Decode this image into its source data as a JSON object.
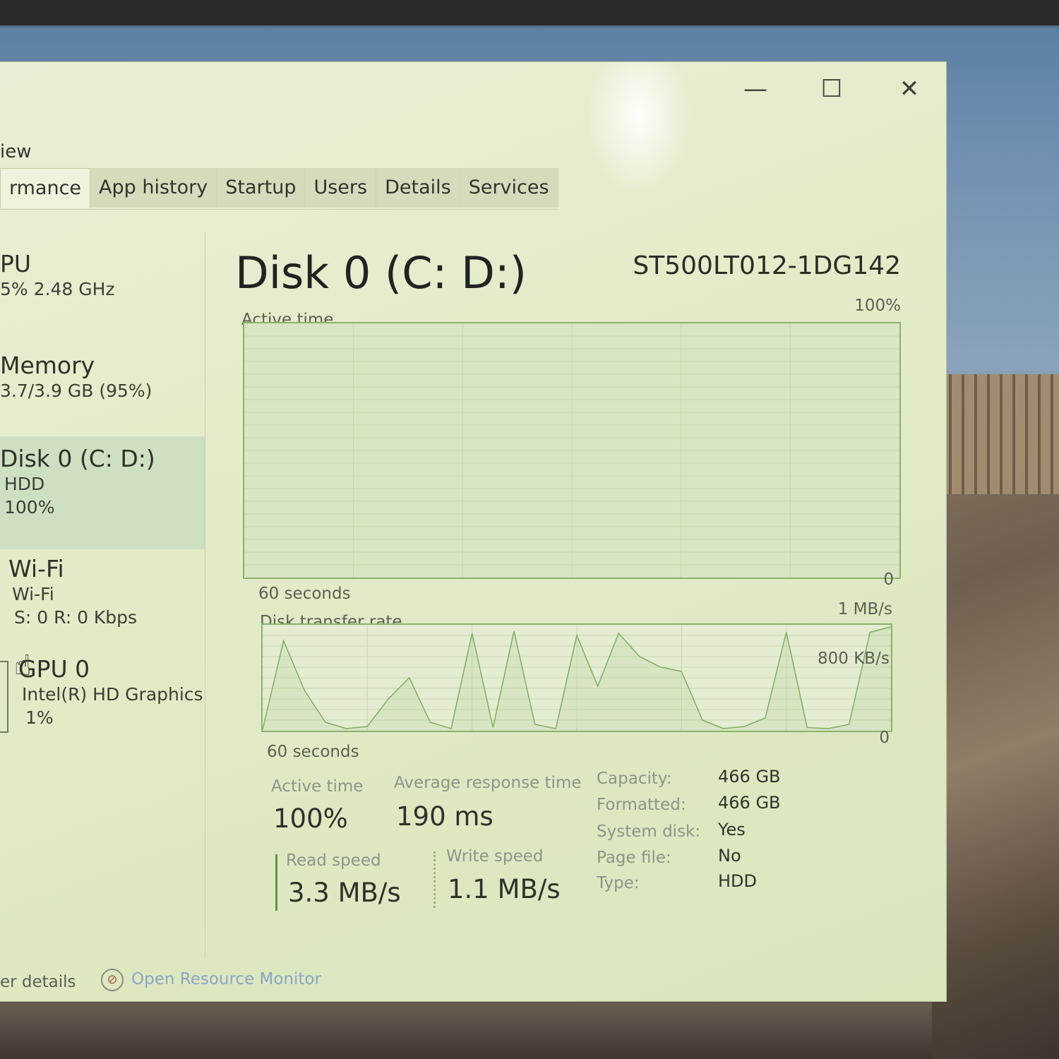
{
  "window": {
    "controls": {
      "minimize": "—",
      "maximize": "☐",
      "close": "✕"
    },
    "menu_partial": "iew"
  },
  "tabs": [
    "rmance",
    "App history",
    "Startup",
    "Users",
    "Details",
    "Services"
  ],
  "sidebar": {
    "items": [
      {
        "title": "PU",
        "sub1": "5% 2.48 GHz",
        "sub2": ""
      },
      {
        "title": "Memory",
        "sub1": "3.7/3.9 GB (95%)",
        "sub2": ""
      },
      {
        "title": "Disk 0 (C: D:)",
        "sub1": "HDD",
        "sub2": "100%"
      },
      {
        "title": "Wi-Fi",
        "sub1": "Wi-Fi",
        "sub2": "S: 0 R: 0 Kbps"
      },
      {
        "title": "GPU 0",
        "sub1": "Intel(R) HD Graphics",
        "sub2": "1%"
      }
    ]
  },
  "main": {
    "title": "Disk 0 (C: D:)",
    "model": "ST500LT012-1DG142",
    "active_graph": {
      "label": "Active time",
      "max_label": "100%",
      "min_label": "0",
      "time_label": "60 seconds",
      "fill_level": 1.0
    },
    "transfer_graph": {
      "label": "Disk transfer rate",
      "max_label": "1 MB/s",
      "mid_label": "800 KB/s",
      "min_label": "0",
      "time_label": "60 seconds"
    },
    "stats": {
      "active_time_label": "Active time",
      "active_time": "100%",
      "avg_response_label": "Average response time",
      "avg_response": "190 ms",
      "read_label": "Read speed",
      "read": "3.3 MB/s",
      "write_label": "Write speed",
      "write": "1.1 MB/s"
    },
    "properties": [
      {
        "key": "Capacity:",
        "value": "466 GB"
      },
      {
        "key": "Formatted:",
        "value": "466 GB"
      },
      {
        "key": "System disk:",
        "value": "Yes"
      },
      {
        "key": "Page file:",
        "value": "No"
      },
      {
        "key": "Type:",
        "value": "HDD"
      }
    ]
  },
  "footer": {
    "fewer_details": "er details",
    "resource_monitor": "Open Resource Monitor"
  },
  "chart_data": {
    "type": "line",
    "title": "Disk transfer rate",
    "ylim": [
      0,
      1000
    ],
    "unit": "KB/s",
    "x": [
      0,
      2,
      4,
      6,
      8,
      10,
      12,
      14,
      16,
      18,
      20,
      22,
      24,
      26,
      28,
      30,
      32,
      34,
      36,
      38,
      40,
      42,
      44,
      46,
      48,
      50,
      52,
      54,
      56,
      58,
      60
    ],
    "series": [
      {
        "values": [
          10,
          850,
          380,
          80,
          20,
          40,
          300,
          500,
          80,
          20,
          920,
          30,
          940,
          60,
          20,
          900,
          420,
          920,
          700,
          600,
          560,
          100,
          20,
          40,
          120,
          930,
          30,
          20,
          60,
          930,
          980
        ]
      }
    ]
  }
}
